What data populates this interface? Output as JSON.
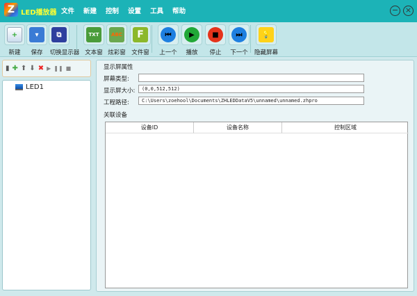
{
  "app": {
    "title": "LED播放器",
    "menu": [
      "文件",
      "新建",
      "控制",
      "设置",
      "工具",
      "帮助"
    ]
  },
  "toolbar": [
    {
      "label": "新建",
      "icon": "new-file-icon"
    },
    {
      "label": "保存",
      "icon": "save-icon"
    },
    {
      "label": "切换显示器",
      "icon": "switch-display-icon"
    },
    {
      "label": "文本窗",
      "icon": "text-window-icon",
      "glyph": "TXT"
    },
    {
      "label": "炫彩窗",
      "icon": "colorful-window-icon",
      "glyph": "ABC"
    },
    {
      "label": "文件窗",
      "icon": "file-window-icon",
      "glyph": "F"
    },
    {
      "label": "上一个",
      "icon": "previous-icon",
      "glyph": "⏮"
    },
    {
      "label": "播放",
      "icon": "play-icon",
      "glyph": "▶"
    },
    {
      "label": "停止",
      "icon": "stop-icon",
      "glyph": "■"
    },
    {
      "label": "下一个",
      "icon": "next-icon",
      "glyph": "⏭"
    },
    {
      "label": "隐藏屏幕",
      "icon": "lightbulb-icon",
      "glyph": "💡"
    }
  ],
  "tree": {
    "items": [
      {
        "label": "LED1",
        "icon": "monitor-icon"
      }
    ]
  },
  "properties": {
    "section": "显示屏属性",
    "screen_type_label": "屏幕类型:",
    "screen_type": "",
    "size_label": "显示屏大小:",
    "size": "(0,0,512,512)",
    "path_label": "工程路径:",
    "path": "C:\\Users\\zoehool\\Documents\\ZHLEDDataV5\\unnamed\\unnamed.zhpro"
  },
  "devices": {
    "section": "关联设备",
    "columns": [
      "设备ID",
      "设备名称",
      "控制区域"
    ],
    "rows": []
  }
}
